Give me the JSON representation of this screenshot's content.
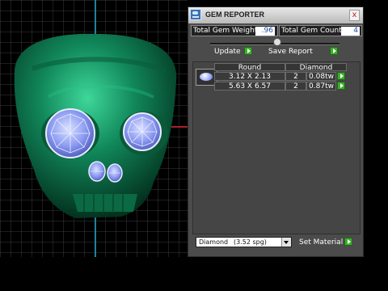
{
  "window": {
    "title": "GEM REPORTER",
    "close_glyph": "x",
    "icon": "app-icon"
  },
  "summary": {
    "total_weight_label": "Total Gem Weight",
    "total_weight_value": ".96",
    "total_count_label": "Total Gem Count",
    "total_count_value": "4"
  },
  "toolbar": {
    "update_label": "Update",
    "save_report_label": "Save Report"
  },
  "table": {
    "headers": [
      "Round",
      "Diamond"
    ],
    "rows": [
      {
        "size": "3.12 X 2.13",
        "count": "2",
        "weight": "0.08tw"
      },
      {
        "size": "5.63 X 6.57",
        "count": "2",
        "weight": "0.87tw"
      }
    ]
  },
  "material": {
    "select_name": "Diamond",
    "select_spg": "(3.52 spg)",
    "set_label": "Set Material"
  },
  "colors": {
    "accent_green": "#3cae2c",
    "gem_blue": "#9aa8ff",
    "skull_green": "#0f7a4a"
  }
}
